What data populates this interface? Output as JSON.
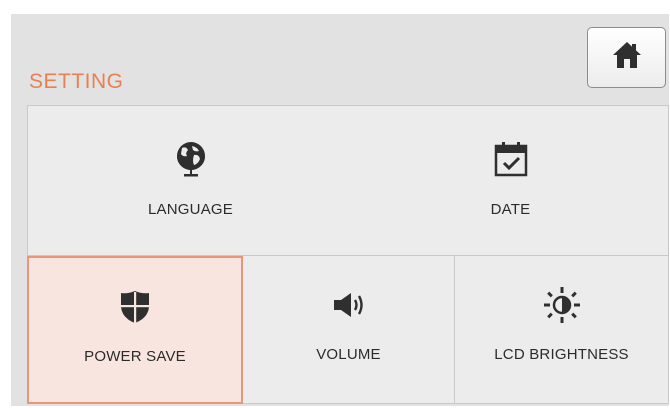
{
  "header": {
    "title": "SETTING",
    "home_icon": "home-icon"
  },
  "tiles": [
    {
      "label": "LANGUAGE",
      "icon": "globe-icon"
    },
    {
      "label": "DATE",
      "icon": "calendar-check-icon"
    },
    {
      "label": "POWER SAVE",
      "icon": "shield-icon",
      "selected": true
    },
    {
      "label": "VOLUME",
      "icon": "speaker-icon"
    },
    {
      "label": "LCD BRIGHTNESS",
      "icon": "brightness-icon"
    }
  ],
  "colors": {
    "title": "#e98053",
    "selected_bg": "#f9e5df",
    "selected_border": "#e8967a",
    "icon": "#2f2f2f"
  }
}
